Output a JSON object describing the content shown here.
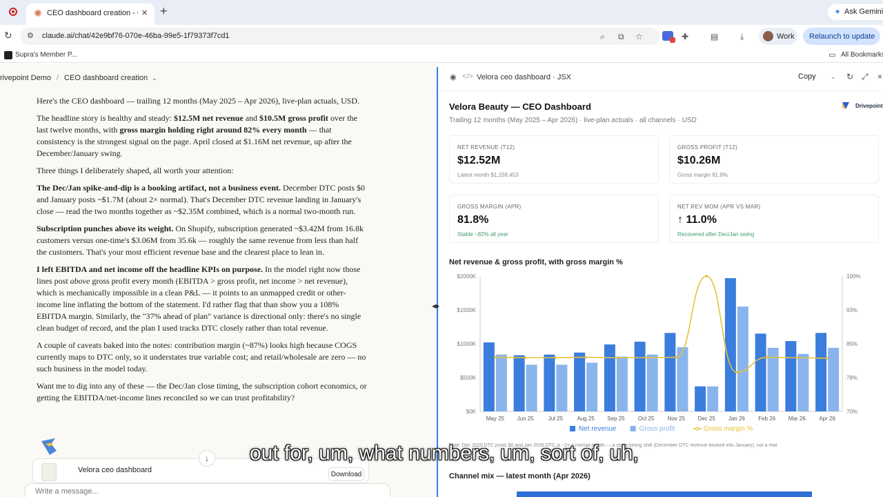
{
  "browser": {
    "tab_title": "CEO dashboard creation - Cl",
    "url": "claude.ai/chat/42e9bf76-070e-46ba-99e5-1f79373f7cd1",
    "ask_gemini": "Ask Gemini",
    "profile": "Work",
    "relaunch": "Relaunch to update",
    "bookmark": "Supra's Member P...",
    "all_bookmarks": "All Bookmarks"
  },
  "chat": {
    "project": "rivepoint Demo",
    "conversation": "CEO dashboard creation",
    "p1": "Here's the CEO dashboard — trailing 12 months (May 2025 – Apr 2026), live-plan actuals, USD.",
    "p2_a": "The headline story is healthy and steady: ",
    "p2_b1": "$12.5M net revenue",
    "p2_c": " and ",
    "p2_b2": "$10.5M gross profit",
    "p2_d": " over the last twelve months, with ",
    "p2_b3": "gross margin holding right around 82% every month",
    "p2_e": " — that consistency is the strongest signal on the page. April closed at $1.16M net revenue, up after the December/January swing.",
    "p3": "Three things I deliberately shaped, all worth your attention:",
    "p4_b": "The Dec/Jan spike-and-dip is a booking artifact, not a business event.",
    "p4_t": " December DTC posts $0 and January posts ~$1.7M (about 2× normal). That's December DTC revenue landing in January's close — read the two months together as ~$2.35M combined, which is a normal two-month run.",
    "p5_b": "Subscription punches above its weight.",
    "p5_t": " On Shopify, subscription generated ~$3.42M from 16.8k customers versus one-time's $3.06M from 35.6k — roughly the same revenue from less than half the customers. That's your most efficient revenue base and the clearest place to lean in.",
    "p6_b": "I left EBITDA and net income off the headline KPIs on purpose.",
    "p6_t1": " In the model right now those lines post ",
    "p6_i": "above",
    "p6_t2": " gross profit every month (EBITDA > gross profit, net income > net revenue), which is mechanically impossible in a clean P&L — it points to an unmapped credit or other-income line inflating the bottom of the statement. I'd rather flag that than show you a 108% EBITDA margin. Similarly, the \"37% ahead of plan\" variance is directional only: there's no single clean budget of record, and the plan I used tracks DTC closely rather than total revenue.",
    "p7": "A couple of caveats baked into the notes: contribution margin (~87%) looks high because COGS currently maps to DTC only, so it understates true variable cost; and retail/wholesale are zero — no such business in the model today.",
    "p8": "Want me to dig into any of these — the Dec/Jan close timing, the subscription cohort economics, or getting the EBITDA/net-income lines reconciled so we can trust profitability?",
    "artifact_card_title": "Velora ceo dashboard",
    "download": "Download",
    "composer_placeholder": "Write a message..."
  },
  "artifact": {
    "name": "Velora ceo dashboard",
    "type": "JSX",
    "copy": "Copy",
    "title": "Velora Beauty — CEO Dashboard",
    "subtitle": "Trailing 12 months (May 2025 – Apr 2026) · live-plan actuals · all channels · USD",
    "brand": "Drivepoint",
    "kpis": [
      {
        "label": "NET REVENUE (T12)",
        "value": "$12.52M",
        "note": "Latest month $1,158,453",
        "good": false
      },
      {
        "label": "GROSS PROFIT (T12)",
        "value": "$10.26M",
        "note": "Gross margin 81.9%",
        "good": false
      },
      {
        "label": "GROSS MARGIN (APR)",
        "value": "81.8%",
        "note": "Stable ~82% all year",
        "good": true
      },
      {
        "label": "NET REV MOM (APR VS MAR)",
        "value": "↑ 11.0%",
        "note": "Recovered after Dec/Jan swing",
        "good": true
      }
    ],
    "chart_note": "Note: Dec 2025 DTC posts $0 and Jan 2026 DTC is ~2× a normal month — a close-timing shift (December DTC revenue booked into January), not a real",
    "channel_title": "Channel mix — latest month (Apr 2026)"
  },
  "chart_data": {
    "type": "bar",
    "title": "Net revenue & gross profit, with gross margin %",
    "categories": [
      "May 25",
      "Jun 25",
      "Jul 25",
      "Aug 25",
      "Sep 25",
      "Oct 25",
      "Nov 25",
      "Dec 25",
      "Jan 26",
      "Feb 26",
      "Mar 26",
      "Apr 26"
    ],
    "series": [
      {
        "name": "Net revenue",
        "values": [
          1020000,
          830000,
          840000,
          870000,
          990000,
          1030000,
          1160000,
          370000,
          1970000,
          1150000,
          1040000,
          1160000
        ],
        "color": "#3b7ddd",
        "axis": "left"
      },
      {
        "name": "Gross profit",
        "values": [
          840000,
          690000,
          690000,
          720000,
          810000,
          840000,
          950000,
          370000,
          1550000,
          940000,
          850000,
          940000
        ],
        "color": "#8ab4ec",
        "axis": "left"
      },
      {
        "name": "Gross margin %",
        "values": [
          82.0,
          81.9,
          81.9,
          82.0,
          81.9,
          81.9,
          82.0,
          100.0,
          78.7,
          82.0,
          81.9,
          81.8
        ],
        "color": "#e6c23a",
        "axis": "right"
      }
    ],
    "y_left_ticks": [
      "$0K",
      "$500K",
      "$1000K",
      "$1500K",
      "$2000K"
    ],
    "y_right_ticks": [
      "70%",
      "78%",
      "85%",
      "93%",
      "100%"
    ],
    "ylim_left": [
      0,
      2000000
    ],
    "ylim_right": [
      70,
      100
    ],
    "legend_position": "bottom",
    "grid": false
  },
  "caption": "out for, um, what numbers, um, sort of, uh,"
}
